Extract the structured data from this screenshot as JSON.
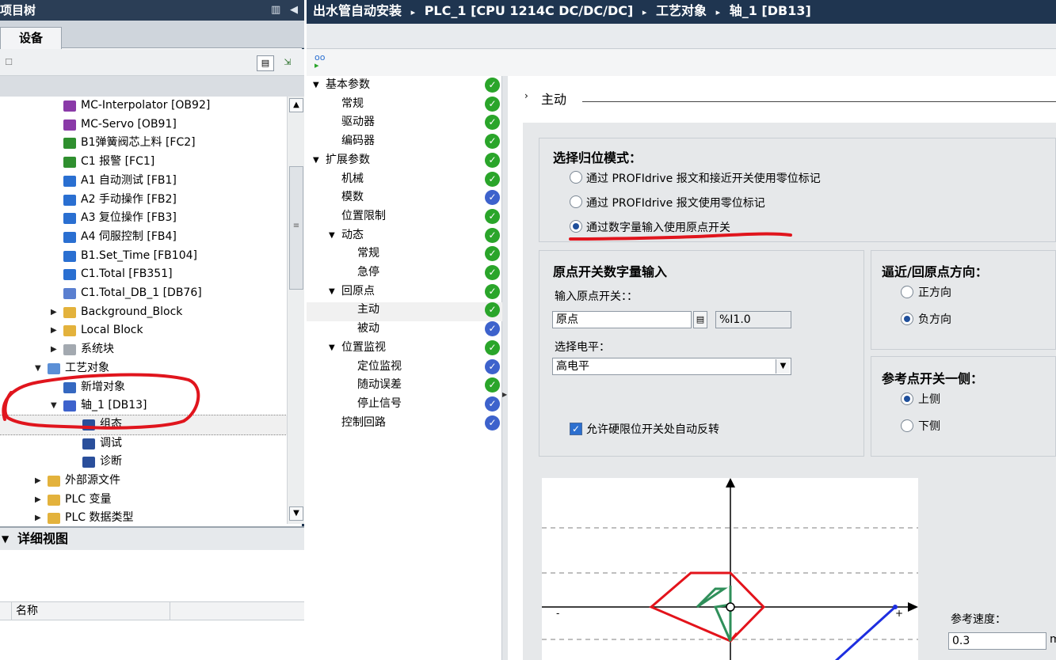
{
  "left_panel": {
    "title": "项目树",
    "collapse_glyph": "◀",
    "tab_devices": "设备",
    "tree": [
      {
        "label": "MC-Interpolator [OB92]",
        "icon": "ob-block-icon",
        "color": "#8a3aa8",
        "indent": 80,
        "toggle": ""
      },
      {
        "label": "MC-Servo [OB91]",
        "icon": "ob-block-icon",
        "color": "#8a3aa8",
        "indent": 80,
        "toggle": ""
      },
      {
        "label": "B1弹簧阀芯上料 [FC2]",
        "icon": "fc-block-icon",
        "color": "#2f8f2f",
        "indent": 80,
        "toggle": ""
      },
      {
        "label": "C1 报警 [FC1]",
        "icon": "fc-block-icon",
        "color": "#2f8f2f",
        "indent": 80,
        "toggle": ""
      },
      {
        "label": "A1 自动测试 [FB1]",
        "icon": "fb-block-icon",
        "color": "#2a6fd1",
        "indent": 80,
        "toggle": ""
      },
      {
        "label": "A2 手动操作 [FB2]",
        "icon": "fb-block-icon",
        "color": "#2a6fd1",
        "indent": 80,
        "toggle": ""
      },
      {
        "label": "A3 复位操作 [FB3]",
        "icon": "fb-block-icon",
        "color": "#2a6fd1",
        "indent": 80,
        "toggle": ""
      },
      {
        "label": "A4 伺服控制 [FB4]",
        "icon": "fb-block-icon",
        "color": "#2a6fd1",
        "indent": 80,
        "toggle": ""
      },
      {
        "label": "B1.Set_Time [FB104]",
        "icon": "fb-block-icon",
        "color": "#2a6fd1",
        "indent": 80,
        "toggle": ""
      },
      {
        "label": "C1.Total [FB351]",
        "icon": "fb-block-icon",
        "color": "#2a6fd1",
        "indent": 80,
        "toggle": ""
      },
      {
        "label": "C1.Total_DB_1 [DB76]",
        "icon": "db-block-icon",
        "color": "#5a7fd0",
        "indent": 80,
        "toggle": ""
      },
      {
        "label": "Background_Block",
        "icon": "folder-icon",
        "color": "#e3b23c",
        "indent": 80,
        "toggle": "▶"
      },
      {
        "label": "Local Block",
        "icon": "folder-icon",
        "color": "#e3b23c",
        "indent": 80,
        "toggle": "▶"
      },
      {
        "label": "系统块",
        "icon": "system-folder-icon",
        "color": "#a3a9b0",
        "indent": 80,
        "toggle": "▶"
      },
      {
        "label": "工艺对象",
        "icon": "technology-folder-icon",
        "color": "#5b8fd6",
        "indent": 60,
        "toggle": "▼"
      },
      {
        "label": "新增对象",
        "icon": "add-object-icon",
        "color": "#3568c0",
        "indent": 80,
        "toggle": ""
      },
      {
        "label": "轴_1 [DB13]",
        "icon": "axis-icon",
        "color": "#3d62cc",
        "indent": 80,
        "toggle": "▼"
      },
      {
        "label": "组态",
        "icon": "configuration-icon",
        "color": "#2a4f9b",
        "indent": 104,
        "toggle": ""
      },
      {
        "label": "调试",
        "icon": "commissioning-icon",
        "color": "#2a4f9b",
        "indent": 104,
        "toggle": ""
      },
      {
        "label": "诊断",
        "icon": "diagnostics-icon",
        "color": "#2a4f9b",
        "indent": 104,
        "toggle": ""
      },
      {
        "label": "外部源文件",
        "icon": "external-source-icon",
        "color": "#e3b23c",
        "indent": 60,
        "toggle": "▶"
      },
      {
        "label": "PLC 变量",
        "icon": "plc-tags-icon",
        "color": "#e3b23c",
        "indent": 60,
        "toggle": "▶"
      },
      {
        "label": "PLC 数据类型",
        "icon": "plc-datatypes-icon",
        "color": "#e3b23c",
        "indent": 60,
        "toggle": "▶"
      }
    ],
    "detail_view_title": "详细视图",
    "detail_col_name": "名称"
  },
  "breadcrumb": {
    "project": "出水管自动安装",
    "sep": "▸",
    "plc": "PLC_1 [CPU 1214C DC/DC/DC]",
    "group": "工艺对象",
    "object": "轴_1 [DB13]"
  },
  "nav": [
    {
      "label": "基本参数",
      "indent": 8,
      "toggle": "▼",
      "status": "g"
    },
    {
      "label": "常规",
      "indent": 44,
      "toggle": "",
      "status": "g"
    },
    {
      "label": "驱动器",
      "indent": 44,
      "toggle": "",
      "status": "g"
    },
    {
      "label": "编码器",
      "indent": 44,
      "toggle": "",
      "status": "g"
    },
    {
      "label": "扩展参数",
      "indent": 8,
      "toggle": "▼",
      "status": "g"
    },
    {
      "label": "机械",
      "indent": 44,
      "toggle": "",
      "status": "g"
    },
    {
      "label": "模数",
      "indent": 44,
      "toggle": "",
      "status": "b"
    },
    {
      "label": "位置限制",
      "indent": 44,
      "toggle": "",
      "status": "g"
    },
    {
      "label": "动态",
      "indent": 28,
      "toggle": "▼",
      "status": "g"
    },
    {
      "label": "常规",
      "indent": 64,
      "toggle": "",
      "status": "g"
    },
    {
      "label": "急停",
      "indent": 64,
      "toggle": "",
      "status": "g"
    },
    {
      "label": "回原点",
      "indent": 28,
      "toggle": "▼",
      "status": "g"
    },
    {
      "label": "主动",
      "indent": 64,
      "toggle": "",
      "status": "g"
    },
    {
      "label": "被动",
      "indent": 64,
      "toggle": "",
      "status": "b"
    },
    {
      "label": "位置监视",
      "indent": 28,
      "toggle": "▼",
      "status": "g"
    },
    {
      "label": "定位监视",
      "indent": 64,
      "toggle": "",
      "status": "b"
    },
    {
      "label": "随动误差",
      "indent": 64,
      "toggle": "",
      "status": "g"
    },
    {
      "label": "停止信号",
      "indent": 64,
      "toggle": "",
      "status": "b"
    },
    {
      "label": "控制回路",
      "indent": 44,
      "toggle": "",
      "status": "b"
    }
  ],
  "content": {
    "section_title": "主动",
    "section_prefix": "›",
    "homing_mode": {
      "title": "选择归位模式：",
      "options": [
        "通过 PROFIdrive 报文和接近开关使用零位标记",
        "通过 PROFIdrive 报文使用零位标记",
        "通过数字量输入使用原点开关"
      ],
      "selected": 2
    },
    "home_switch": {
      "title": "原点开关数字量输入",
      "input_label": "输入原点开关：：",
      "input_value": "原点",
      "address": "%I1.0",
      "level_label": "选择电平：",
      "level_value": "高电平",
      "reversal_label": "允许硬限位开关处自动反转"
    },
    "direction": {
      "title": "逼近/回原点方向：",
      "options": [
        "正方向",
        "负方向"
      ],
      "selected": 1
    },
    "side": {
      "title": "参考点开关一侧：",
      "options": [
        "上侧",
        "下侧"
      ],
      "selected": 0
    },
    "ref_speed_label": "参考速度：",
    "ref_speed_value": "0.3",
    "ref_speed_unit": "m",
    "axis_minus": "-",
    "axis_plus": "+"
  },
  "colors": {
    "title_bar": "#1f3550",
    "check_green": "#2aa52a",
    "check_blue": "#3d62cc",
    "annotation_red": "#e0151d"
  }
}
